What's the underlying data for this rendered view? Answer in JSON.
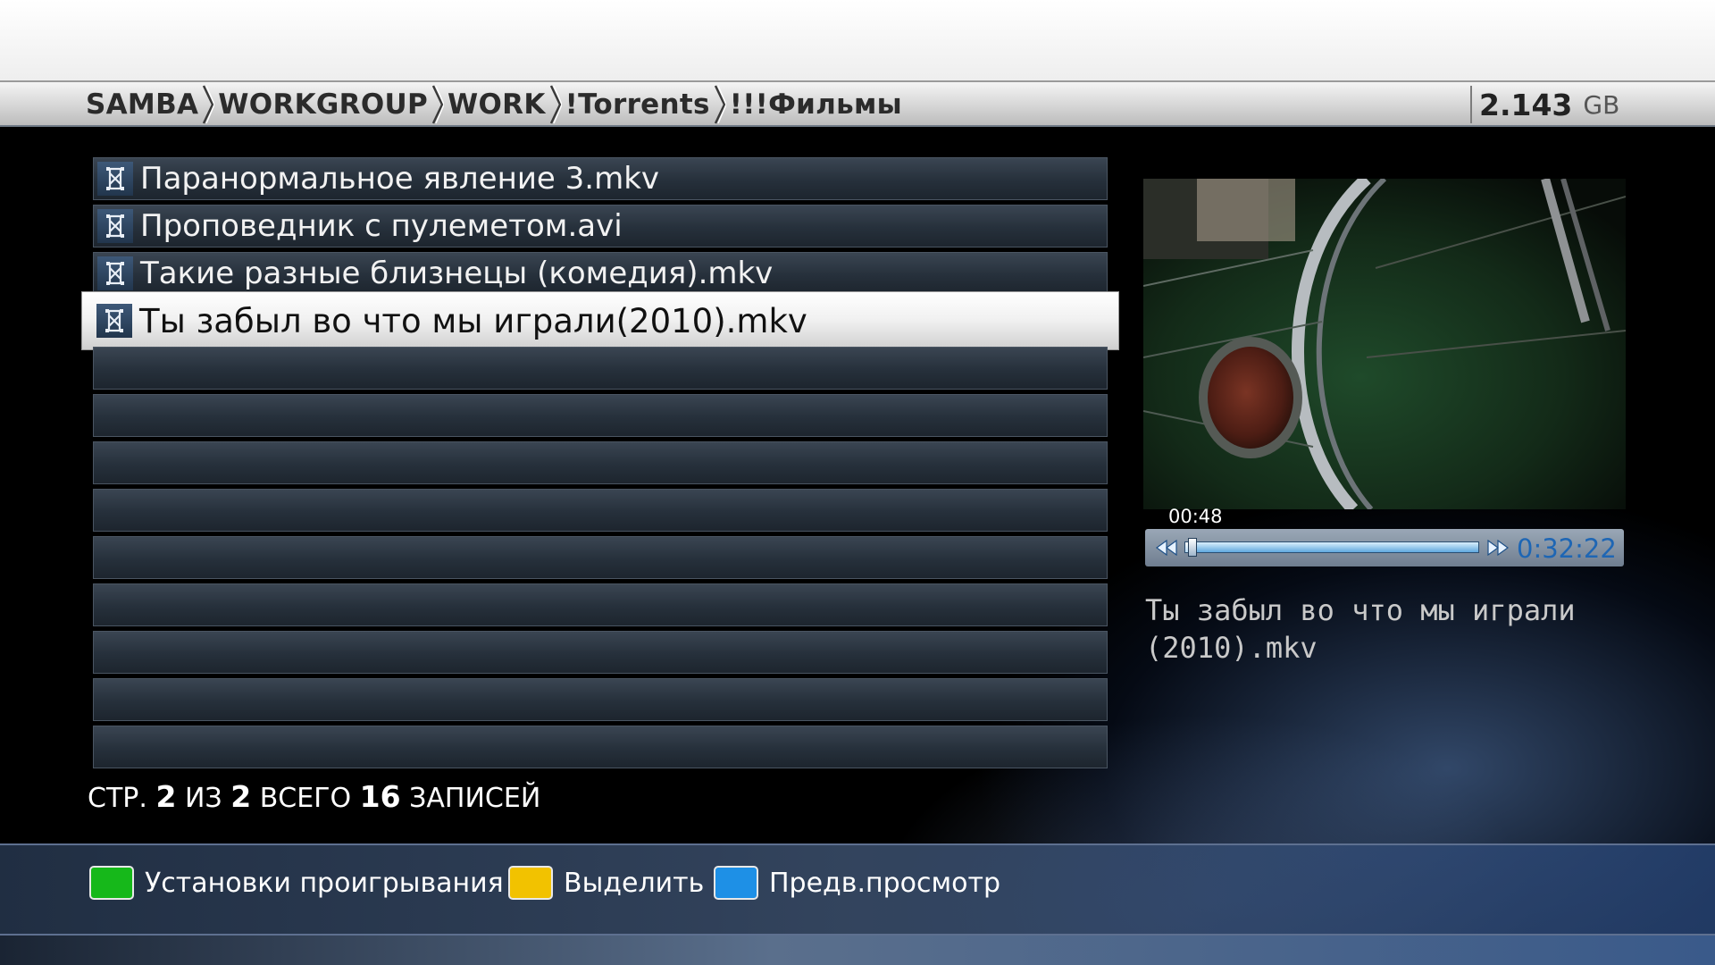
{
  "breadcrumb": [
    "SAMBA",
    "WORKGROUP",
    "WORK",
    "!Torrents",
    "!!!Фильмы"
  ],
  "disk": {
    "value": "2.143",
    "unit": "GB"
  },
  "files": [
    {
      "name": "Паранормальное явление 3.mkv",
      "icon": "video-file-icon"
    },
    {
      "name": "Проповедник с пулеметом.avi",
      "icon": "video-file-icon"
    },
    {
      "name": "Такие разные близнецы (комедия).mkv",
      "icon": "video-file-icon"
    },
    {
      "name": "Ты забыл во что мы играли(2010).mkv",
      "icon": "video-file-icon"
    }
  ],
  "selected_index": 3,
  "empty_rows": 9,
  "page_info": {
    "page_label": "СТР.",
    "page": "2",
    "of_label": "ИЗ",
    "pages": "2",
    "total_label": "ВСЕГО",
    "total": "16",
    "records_label": "ЗАПИСЕЙ"
  },
  "preview": {
    "elapsed": "00:48",
    "duration": "0:32:22",
    "progress_fraction": 0.025,
    "filename": "Ты забыл во что мы играли\n(2010).mkv"
  },
  "legend": [
    {
      "color": "#16b81a",
      "label": "Установки проигрывания"
    },
    {
      "color": "#f2c200",
      "label": "Выделить"
    },
    {
      "color": "#1e90e6",
      "label": "Предв.просмотр"
    }
  ]
}
